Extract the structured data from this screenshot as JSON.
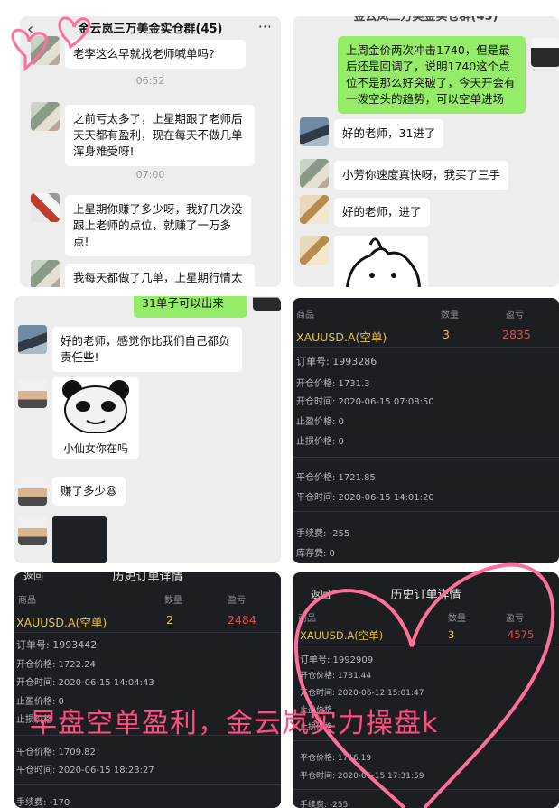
{
  "panel1": {
    "title": "金云岚三万美金实仓群(45)",
    "more": "···",
    "messages": [
      {
        "text": "老李这么早就找老师喊单吗?"
      },
      {
        "time": "06:52"
      },
      {
        "text": "之前亏太多了，上星期跟了老师后天天都有盈利，现在每天不做几单浑身难受呀!"
      },
      {
        "time": "07:00"
      },
      {
        "text": "上星期你赚了多少呀，我好几次没跟上老师的点位，就赚了一万多点!"
      },
      {
        "text": "我每天都做了几单，上星期行情太好了，抛去亏的赚了三万多"
      }
    ]
  },
  "panel2": {
    "title": "金云岚三万美金实仓群(45)",
    "messages": [
      {
        "text": "上周金价两次冲击1740，但是最后还是回调了，说明1740这个点位不是那么好突破了，今天开会有一泼空头的趋势，可以空单进场"
      },
      {
        "text": "好的老师，31进了"
      },
      {
        "text": "小芳你速度真快呀，我买了三手"
      },
      {
        "text": "好的老师，进了"
      }
    ]
  },
  "panel3": {
    "top_partial": "31单子可以出来",
    "messages": [
      {
        "text": "好的老师，感觉你比我们自己都负责任些!"
      },
      {
        "sticker_caption": "小仙女你在吗"
      },
      {
        "text": "赚了多少😆"
      }
    ]
  },
  "panel4": {
    "headers": [
      "商品",
      "数量",
      "盈亏"
    ],
    "symbol": "XAUUSD.A(空单)",
    "qty": "3",
    "pnl": "2835",
    "fields": [
      "订单号: 1993286",
      "开仓价格: 1731.3",
      "开仓时间: 2020-06-15 07:08:50",
      "止盈价格: 0",
      "止损价格: 0"
    ],
    "close_fields": [
      "平仓价格: 1721.85",
      "平仓时间: 2020-06-15 14:01:20"
    ],
    "fee_fields": [
      "手续费: -255",
      "库存费: 0"
    ]
  },
  "panel5": {
    "back": "返回",
    "title": "历史订单详情",
    "headers": [
      "商品",
      "数量",
      "盈亏"
    ],
    "symbol": "XAUUSD.A(空单)",
    "qty": "2",
    "pnl": "2484",
    "fields": [
      "订单号: 1993442",
      "开仓价格: 1722.24",
      "开仓时间: 2020-06-15 14:04:43",
      "止盈价格: 0",
      "止损价格"
    ],
    "close_fields": [
      "平仓价格: 1709.82",
      "平仓时间: 2020-06-15 18:23:27"
    ],
    "fee": "手续费: -170"
  },
  "panel6": {
    "back": "返回",
    "title": "历史订单详情",
    "headers": [
      "商品",
      "数量",
      "盈亏"
    ],
    "symbol": "XAUUSD.A(空单)",
    "qty": "3",
    "pnl": "4575",
    "fields": [
      "订单号: 1992909",
      "开仓价格: 1731.44",
      "开仓时间: 2020-06-12 15:01:47",
      "止盈价格",
      "止损价格"
    ],
    "close_fields": [
      "平仓价格: 1716.19",
      "平仓时间: 2020-06-15 17:31:59"
    ],
    "fee": "手续费: -255"
  },
  "overlay": {
    "caption": "早盘空单盈利，金云岚实力操盘k"
  },
  "colors": {
    "wechat_green": "#95ec69",
    "gold": "#e8c43a",
    "profit_red": "#e04a4a",
    "pink": "#ff4d80"
  }
}
